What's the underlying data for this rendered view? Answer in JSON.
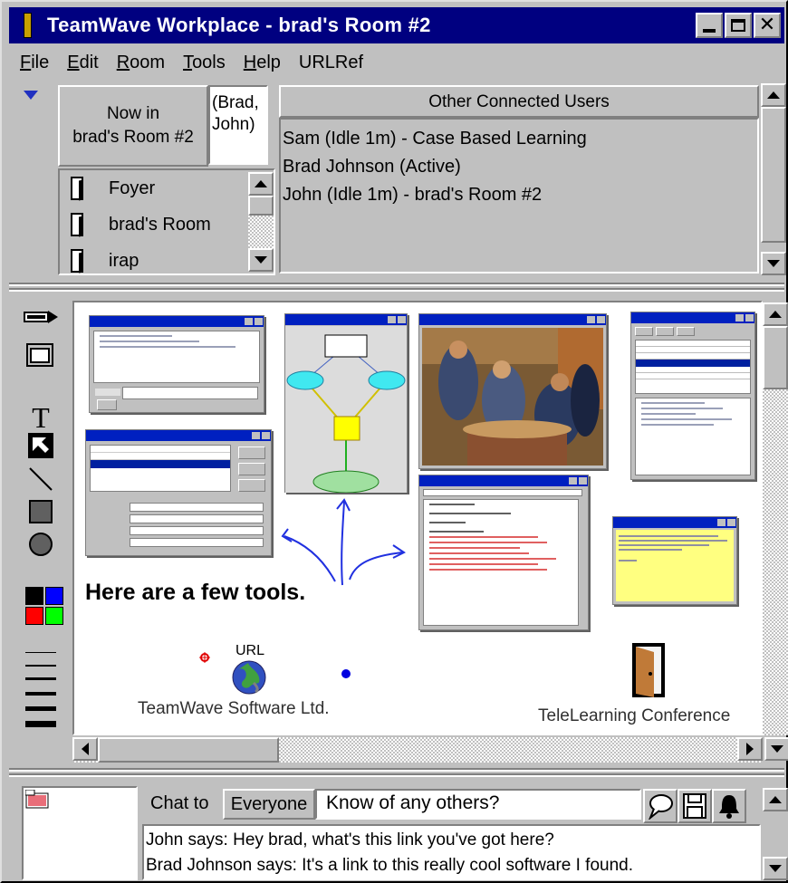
{
  "window": {
    "title": "TeamWave Workplace - brad's Room #2"
  },
  "menu": [
    {
      "label": "File",
      "key": "F",
      "rest": "ile"
    },
    {
      "label": "Edit",
      "key": "E",
      "rest": "dit"
    },
    {
      "label": "Room",
      "key": "R",
      "rest": "oom"
    },
    {
      "label": "Tools",
      "key": "T",
      "rest": "ools"
    },
    {
      "label": "Help",
      "key": "H",
      "rest": "elp"
    },
    {
      "label": "URLRef",
      "key": "",
      "rest": "URLRef"
    }
  ],
  "room": {
    "now_in_line1": "Now in",
    "now_in_line2": "brad's Room #2",
    "occupants_line1": "(Brad,",
    "occupants_line2": "John)",
    "rooms": [
      "Foyer",
      "brad's Room",
      "irap"
    ]
  },
  "users": {
    "header": "Other Connected Users",
    "list": [
      "Sam (Idle 1m) - Case Based Learning",
      "Brad Johnson (Active)",
      "John (Idle 1m) - brad's Room #2"
    ]
  },
  "canvas": {
    "annotation": "Here are a few tools.",
    "url_label": "URL",
    "company_label": "TeamWave Software Ltd.",
    "door_label": "TeleLearning Conference"
  },
  "palette": {
    "colors": [
      "#000000",
      "#0000ff",
      "#ff0000",
      "#00ff00"
    ]
  },
  "chat": {
    "label": "Chat to",
    "recipient": "Everyone",
    "input_value": "Know of any others?",
    "log": [
      "John says: Hey brad, what's this link you've got here?",
      "Brad Johnson says: It's a link to this really cool software I found."
    ]
  },
  "colors": {
    "titlebar": "#000080",
    "face": "#c0c0c0",
    "accent_blue": "#0020c0",
    "sticky_yellow": "#ffff80"
  }
}
